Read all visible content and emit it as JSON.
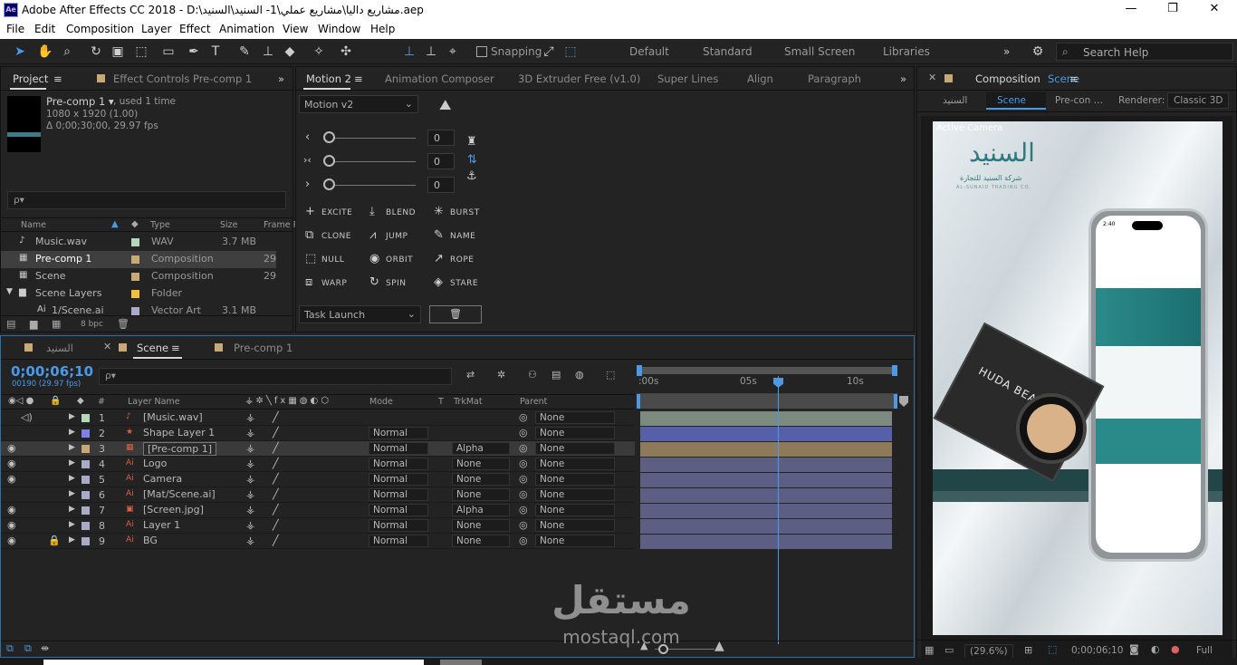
{
  "title_bar": {
    "app_badge": "Ae",
    "title": "Adobe After Effects CC 2018 - D:\\مشاريع داليا\\مشاريع عملي\\1- السنيد\\السنيد.aep",
    "minimize": "—",
    "maximize": "❐",
    "close": "✕"
  },
  "menu": [
    "File",
    "Edit",
    "Composition",
    "Layer",
    "Effect",
    "Animation",
    "View",
    "Window",
    "Help"
  ],
  "toolbar": {
    "snapping_label": "Snapping",
    "workspaces": [
      "Default",
      "Standard",
      "Small Screen",
      "Libraries"
    ],
    "more": "»",
    "search_placeholder": "Search Help"
  },
  "project_panel": {
    "tabs": [
      "Project",
      "Effect Controls Pre-comp 1"
    ],
    "selected_name": "Pre-comp 1 ▾",
    "used": ", used 1 time",
    "info_line1": "1080 x 1920 (1.00)",
    "info_line2": "Δ 0;00;30;00, 29.97 fps",
    "search_placeholder": "ρ▾",
    "columns": [
      "Name",
      "Type",
      "Size",
      "Frame R"
    ],
    "items": [
      {
        "name": "Music.wav",
        "color": "#b3d8b8",
        "type": "WAV",
        "size": "3.7 MB",
        "frame": ""
      },
      {
        "name": "Pre-comp 1",
        "color": "#c8a874",
        "type": "Composition",
        "size": "",
        "frame": "29"
      },
      {
        "name": "Scene",
        "color": "#c8a874",
        "type": "Composition",
        "size": "",
        "frame": "29"
      },
      {
        "name": "Scene Layers",
        "color": "#f0c040",
        "type": "Folder",
        "size": "",
        "frame": ""
      },
      {
        "name": "1/Scene.ai",
        "color": "#a9a9c8",
        "type": "Vector Art",
        "size": "3.1 MB",
        "frame": ""
      }
    ],
    "bpc": "8 bpc"
  },
  "motion_panel": {
    "tabs": [
      "Motion 2",
      "Animation Composer",
      "3D Extruder Free (v1.0)",
      "Super Lines",
      "Align",
      "Paragraph"
    ],
    "preset": "Motion v2",
    "sliders": [
      {
        "icon": "‹",
        "value": "0"
      },
      {
        "icon": "›‹",
        "value": "0"
      },
      {
        "icon": "›",
        "value": "0"
      }
    ],
    "buttons": [
      {
        "icon": "+",
        "label": "EXCITE"
      },
      {
        "icon": "⤓",
        "label": "BLEND"
      },
      {
        "icon": "✳",
        "label": "BURST"
      },
      {
        "icon": "⧉",
        "label": "CLONE"
      },
      {
        "icon": "⩘",
        "label": "JUMP"
      },
      {
        "icon": "✎",
        "label": "NAME"
      },
      {
        "icon": "⬚",
        "label": "NULL"
      },
      {
        "icon": "◉",
        "label": "ORBIT"
      },
      {
        "icon": "↗",
        "label": "ROPE"
      },
      {
        "icon": "⧈",
        "label": "WARP"
      },
      {
        "icon": "↻",
        "label": "SPIN"
      },
      {
        "icon": "◈",
        "label": "STARE"
      }
    ],
    "task": "Task Launch",
    "trash": "🗑"
  },
  "comp_viewer": {
    "tab": "Composition",
    "tab_name": "Scene",
    "breadcrumbs": [
      "السنيد",
      "Scene",
      "Pre-con …"
    ],
    "renderer_label": "Renderer:",
    "renderer_value": "Classic 3D",
    "active_camera": "Active Camera",
    "logo_arabic": "السنيد",
    "logo_sub": "شركة السنيد للتجارة",
    "logo_en": "AL-SUNAID TRADING CO.",
    "phone_time": "2:40",
    "product_brand": "HUDA BEAUTY",
    "zoom": "(29.6%)",
    "timecode": "0;00;06;10",
    "resolution": "Full",
    "watermark": "مستقل",
    "watermark_url": "mostaql.com"
  },
  "timeline": {
    "tabs": [
      "السنيد",
      "Scene",
      "Pre-comp 1"
    ],
    "timecode": "0;00;06;10",
    "frame_info": "00190 (29.97 fps)",
    "search_placeholder": "ρ▾",
    "columns": {
      "num": "#",
      "layer_name": "Layer Name",
      "mode": "Mode",
      "t": "T",
      "trkmat": "TrkMat",
      "parent": "Parent"
    },
    "ruler": [
      ":00s",
      "05s",
      "10s"
    ],
    "current_time_fraction": 0.5,
    "layers": [
      {
        "num": "1",
        "name": "[Music.wav]",
        "color": "#b3d8b8",
        "icon": "♪",
        "mode": "",
        "trkmat": "",
        "parent": "None",
        "bar": "#7d8a80",
        "visible": false
      },
      {
        "num": "2",
        "name": "Shape Layer 1",
        "color": "#8080e8",
        "icon": "★",
        "mode": "Normal",
        "trkmat": "",
        "parent": "None",
        "bar": "#5560a8",
        "visible": false
      },
      {
        "num": "3",
        "name": "[Pre-comp 1]",
        "color": "#c8a874",
        "icon": "▦",
        "mode": "Normal",
        "trkmat": "Alpha",
        "parent": "None",
        "bar": "#8c7a5a",
        "visible": true
      },
      {
        "num": "4",
        "name": "Logo",
        "color": "#a9a9c8",
        "icon": "Ai",
        "mode": "Normal",
        "trkmat": "None",
        "parent": "None",
        "bar": "#5d5e83",
        "visible": true
      },
      {
        "num": "5",
        "name": "Camera",
        "color": "#a9a9c8",
        "icon": "Ai",
        "mode": "Normal",
        "trkmat": "None",
        "parent": "None",
        "bar": "#5d5e83",
        "visible": true
      },
      {
        "num": "6",
        "name": "[Mat/Scene.ai]",
        "color": "#a9a9c8",
        "icon": "Ai",
        "mode": "Normal",
        "trkmat": "None",
        "parent": "None",
        "bar": "#5d5e83",
        "visible": false
      },
      {
        "num": "7",
        "name": "[Screen.jpg]",
        "color": "#a9a9c8",
        "icon": "▣",
        "mode": "Normal",
        "trkmat": "Alpha",
        "parent": "None",
        "bar": "#5d5e83",
        "visible": true
      },
      {
        "num": "8",
        "name": "Layer 1",
        "color": "#a9a9c8",
        "icon": "Ai",
        "mode": "Normal",
        "trkmat": "None",
        "parent": "None",
        "bar": "#5d5e83",
        "visible": true
      },
      {
        "num": "9",
        "name": "BG",
        "color": "#a9a9c8",
        "icon": "Ai",
        "mode": "Normal",
        "trkmat": "None",
        "parent": "None",
        "bar": "#5d5e83",
        "visible": true
      }
    ]
  },
  "colors": {
    "accent": "#4b9ae8",
    "panel": "#232323",
    "dark": "#1a1a1a"
  }
}
